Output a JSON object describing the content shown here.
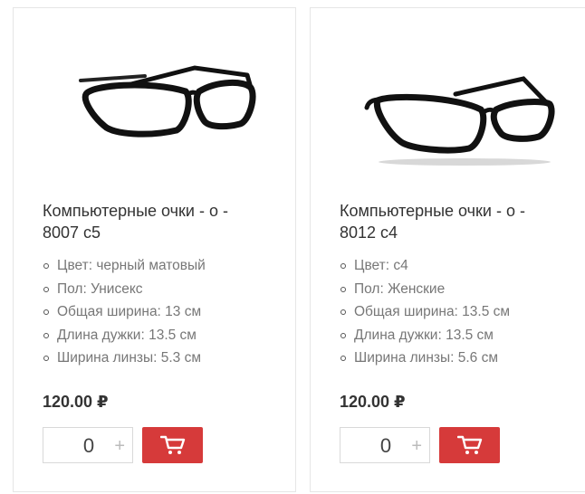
{
  "products": [
    {
      "title": "Компьютерные очки - о - 8007 c5",
      "specs": [
        "Цвет: черный матовый",
        "Пол: Унисекс",
        "Общая ширина: 13 см",
        "Длина дужки: 13.5 см",
        "Ширина линзы: 5.3 см"
      ],
      "price": "120.00 ₽",
      "quantity": "0",
      "qty_plus": "+"
    },
    {
      "title": "Компьютерные очки - о - 8012 c4",
      "specs": [
        "Цвет: c4",
        "Пол: Женские",
        "Общая ширина: 13.5 см",
        "Длина дужки: 13.5 см",
        "Ширина линзы: 5.6 см"
      ],
      "price": "120.00 ₽",
      "quantity": "0",
      "qty_plus": "+"
    }
  ],
  "icons": {
    "cart": "cart-icon",
    "bullet": "circle-bullet-icon",
    "plus": "plus-icon"
  },
  "colors": {
    "cart_button": "#d63a3a",
    "border": "#e6e6e6",
    "spec_text": "#777777",
    "title_text": "#333333"
  }
}
